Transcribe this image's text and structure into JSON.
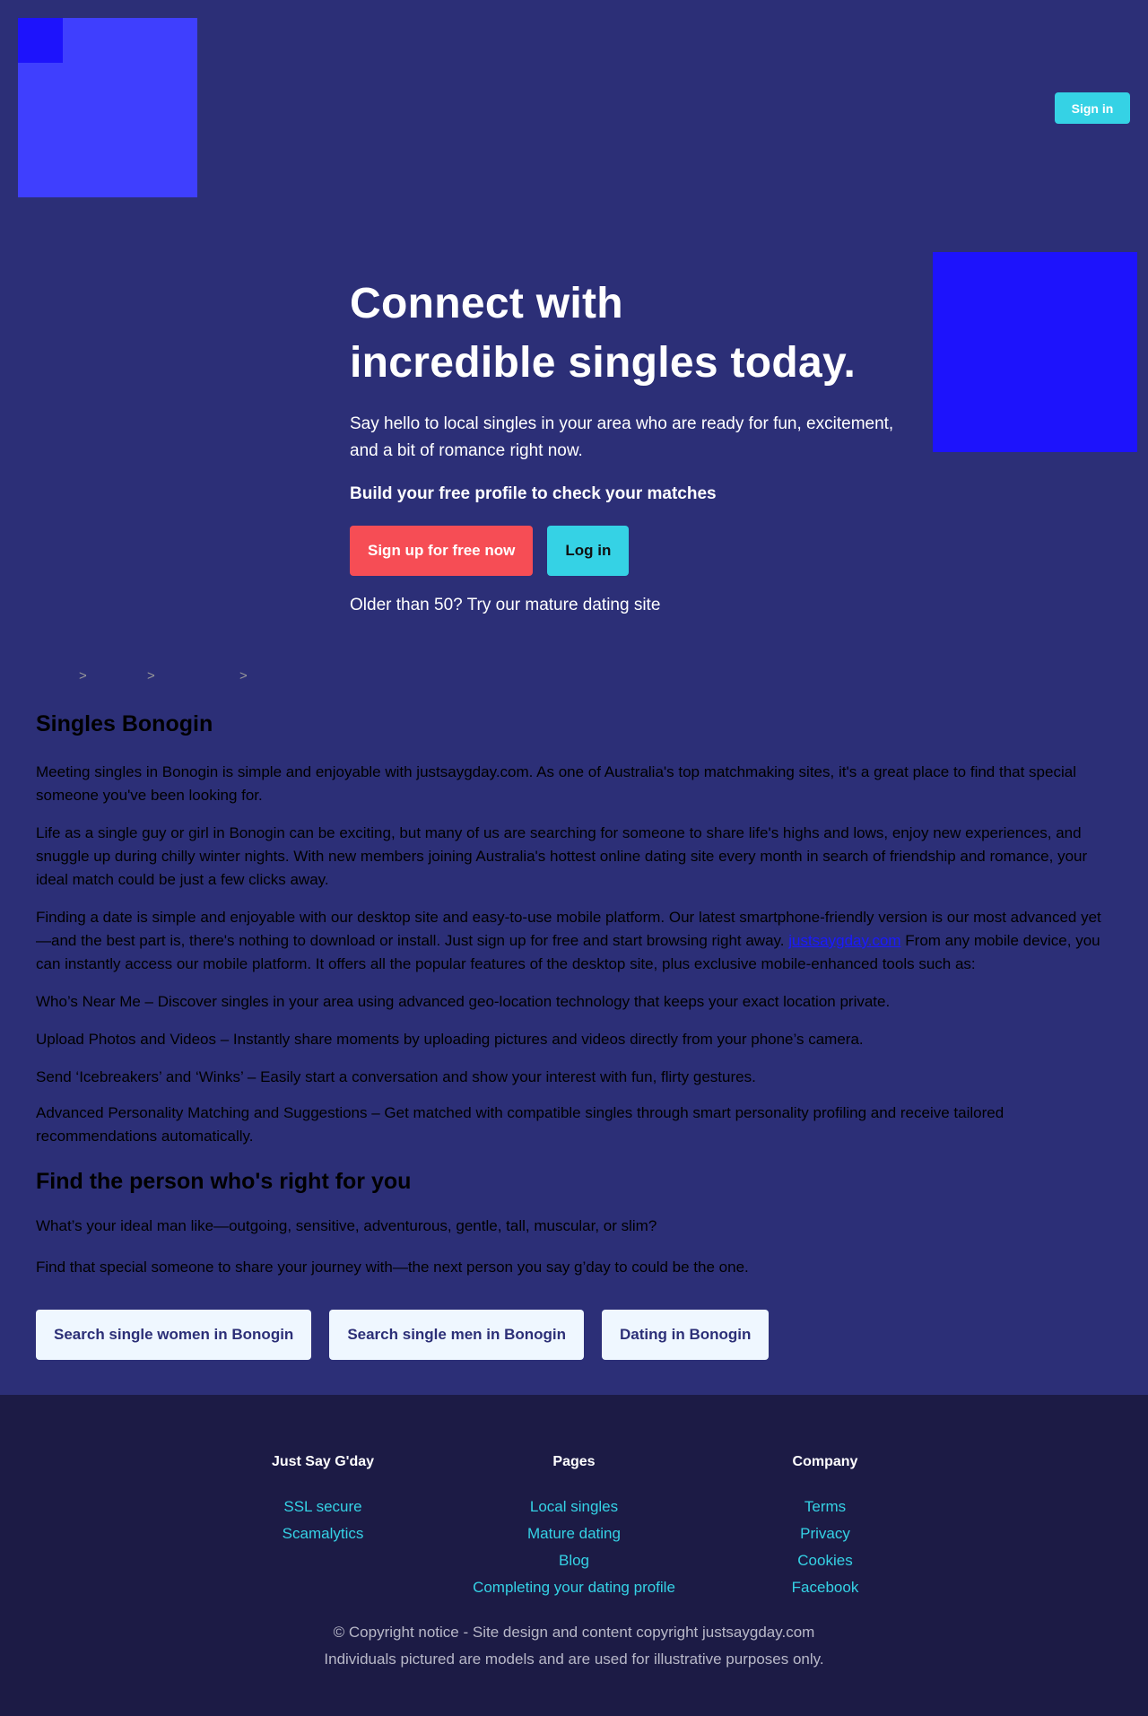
{
  "header": {
    "signin_label": "Sign in"
  },
  "hero": {
    "title_line1": "Connect with",
    "title_line2": "incredible singles today.",
    "lead": "Say hello to local singles in your area who are ready for fun, excitement, and a bit of romance right now.",
    "build": "Build your free profile to check your matches",
    "signup_label": "Sign up for free now",
    "login_label": "Log in",
    "older": "Older than 50? Try our mature dating site"
  },
  "breadcrumb": [
    ">",
    ">",
    ">"
  ],
  "main": {
    "heading": "Singles Bonogin",
    "p1": "Meeting singles in Bonogin is simple and enjoyable with justsaygday.com. As one of Australia's top matchmaking sites, it's a great place to find that special someone you've been looking for.",
    "p2": "Life as a single guy or girl in Bonogin can be exciting, but many of us are searching for someone to share life's highs and lows, enjoy new experiences, and snuggle up during chilly winter nights. With new members joining Australia's hottest online dating site every month in search of friendship and romance, your ideal match could be just a few clicks away.",
    "p3_before": "Finding a date is simple and enjoyable with our desktop site and easy-to-use mobile platform. Our latest smartphone-friendly version is our most advanced yet—and the best part is, there's nothing to download or install. Just sign up for free and start browsing right away. ",
    "p3_link": "justsaygday.com",
    "p3_after": " From any mobile device, you can instantly access our mobile platform. It offers all the popular features of the desktop site, plus exclusive mobile-enhanced tools such as:",
    "feature1": "Who’s Near Me – Discover singles in your area using advanced geo-location technology that keeps your exact location private.",
    "feature2": "Upload Photos and Videos – Instantly share moments by uploading pictures and videos directly from your phone’s camera.",
    "feature3": "Send ‘Icebreakers’ and ‘Winks’ – Easily start a conversation and show your interest with fun, flirty gestures.",
    "feature4": "Advanced Personality Matching and Suggestions – Get matched with compatible singles through smart personality profiling and receive tailored recommendations automatically.",
    "heading2": "Find the person who's right for you",
    "p4": "What’s your ideal man like—outgoing, sensitive, adventurous, gentle, tall, muscular, or slim?",
    "p5": "Find that special someone to share your journey with—the next person you say g’day to could be the one.",
    "btn_women": "Search single women in Bonogin",
    "btn_men": "Search single men in Bonogin",
    "btn_dating": "Dating in Bonogin"
  },
  "footer": {
    "col1": {
      "title": "Just Say G'day",
      "links": [
        "SSL secure",
        "Scamalytics"
      ]
    },
    "col2": {
      "title": "Pages",
      "links": [
        "Local singles",
        "Mature dating",
        "Blog",
        "Completing your dating profile"
      ]
    },
    "col3": {
      "title": "Company",
      "links": [
        "Terms",
        "Privacy",
        "Cookies",
        "Facebook"
      ]
    },
    "copyright": "© Copyright notice - Site design and content copyright justsaygday.com",
    "disclaimer": "Individuals pictured are models and are used for illustrative purposes only."
  },
  "colors": {
    "background": "#2c2f77",
    "accent_cyan": "#35d2e5",
    "accent_red": "#f64d55",
    "footer_bg": "#1c1b45",
    "placeholder_blue": "#3f3ffe",
    "placeholder_dark_blue": "#1d13fc"
  }
}
